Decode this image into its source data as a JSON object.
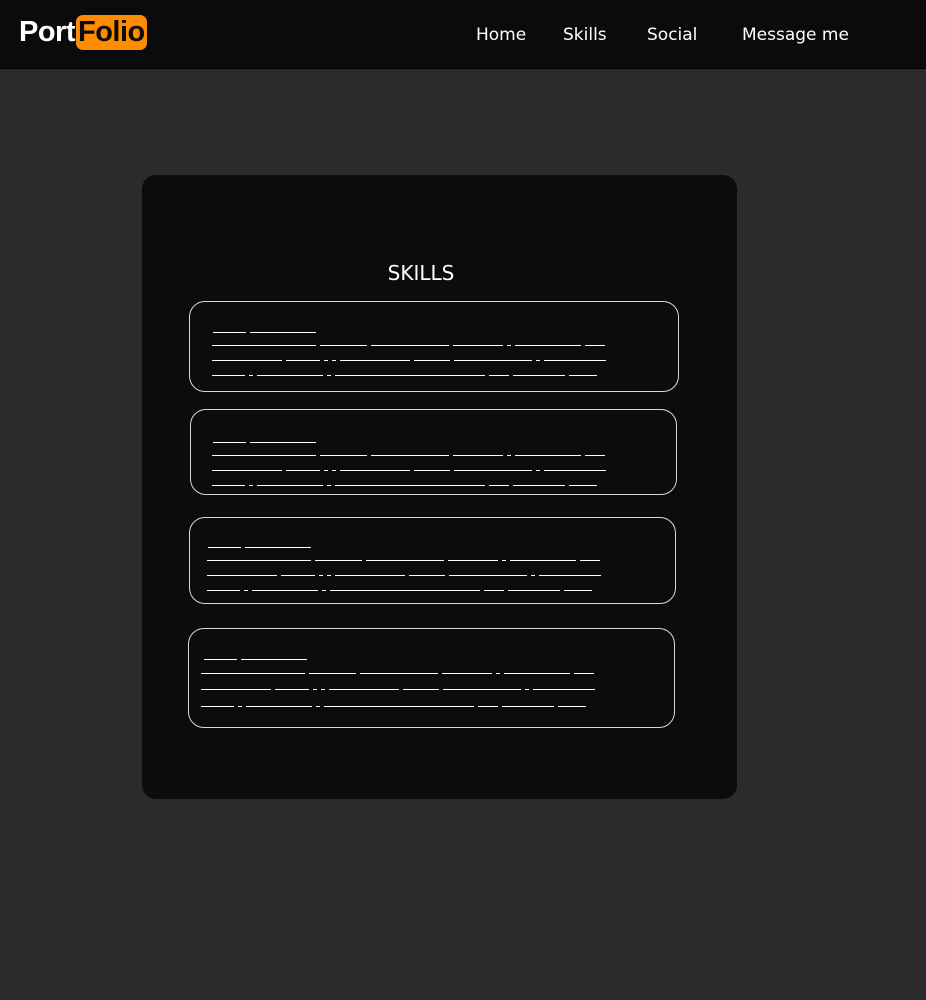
{
  "header": {
    "logo_part1": "Port",
    "logo_part2": "Folio",
    "nav": {
      "home": "Home",
      "skills": "Skills",
      "social": "Social",
      "message": "Message me"
    }
  },
  "skills_section": {
    "title": "SKILLS"
  },
  "colors": {
    "page_bg": "#2b2b2b",
    "navbar_bg": "#0b0b0b",
    "card_bg": "#0c0c0c",
    "accent": "#ff8c00",
    "text": "#ffffff"
  }
}
